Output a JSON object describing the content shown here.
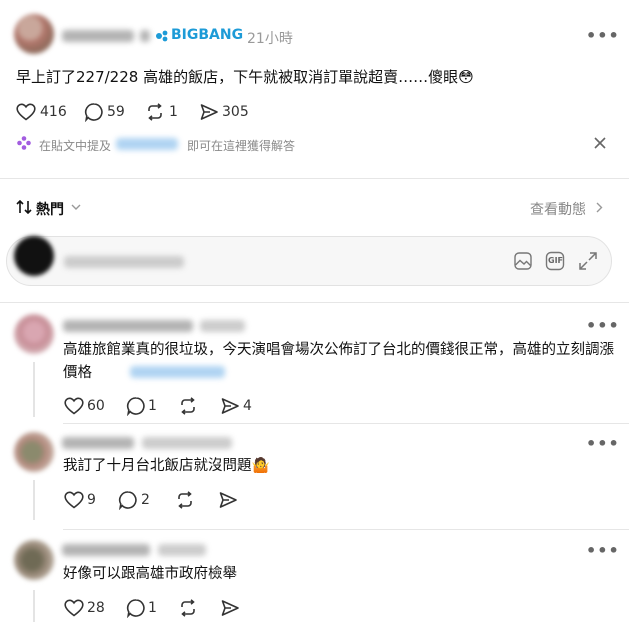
{
  "post": {
    "tag": "BIGBANG",
    "time": "21小時",
    "text": "早上訂了227/228 高雄的飯店，下午就被取消訂單說超賣……傻眼😳",
    "likes": "416",
    "comments": "59",
    "reposts": "1",
    "shares": "305"
  },
  "ai_hint": {
    "prefix": "在貼文中提及",
    "suffix": "即可在這裡獲得解答"
  },
  "sort": {
    "label": "熱門",
    "activity": "查看動態"
  },
  "composer": {
    "gif_label": "GIF"
  },
  "comments": [
    {
      "text": "高雄旅館業真的很垃圾，今天演唱會場次公佈訂了台北的價錢很正常，高雄的立刻調漲價格",
      "likes": "60",
      "replies": "1",
      "shares": "4"
    },
    {
      "text": "我訂了十月台北飯店就沒問題🤷",
      "likes": "9",
      "replies": "2"
    },
    {
      "text": "好像可以跟高雄市政府檢舉",
      "likes": "28",
      "replies": "1"
    }
  ],
  "colors": {
    "accent": "#1d9bd7",
    "ai_icon": "#a35de0"
  },
  "icons": [
    "more-icon",
    "verified-badge-icon",
    "heart-icon",
    "comment-icon",
    "repost-icon",
    "share-icon",
    "sparkle-icon",
    "close-icon",
    "sort-icon",
    "chevron-down-icon",
    "chevron-right-icon",
    "image-icon",
    "gif-icon",
    "expand-icon"
  ]
}
